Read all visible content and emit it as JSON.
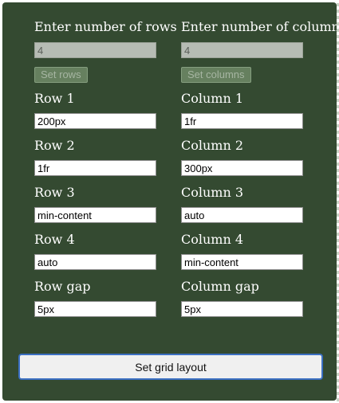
{
  "rows": {
    "count_label": "Enter number of rows",
    "count_value": "4",
    "set_button": "Set rows",
    "items": [
      {
        "label": "Row 1",
        "value": "200px"
      },
      {
        "label": "Row 2",
        "value": "1fr"
      },
      {
        "label": "Row 3",
        "value": "min-content"
      },
      {
        "label": "Row 4",
        "value": "auto"
      }
    ],
    "gap_label": "Row gap",
    "gap_value": "5px"
  },
  "columns": {
    "count_label": "Enter number of columns",
    "count_value": "4",
    "set_button": "Set columns",
    "items": [
      {
        "label": "Column 1",
        "value": "1fr"
      },
      {
        "label": "Column 2",
        "value": "300px"
      },
      {
        "label": "Column 3",
        "value": "auto"
      },
      {
        "label": "Column 4",
        "value": "min-content"
      }
    ],
    "gap_label": "Column gap",
    "gap_value": "5px"
  },
  "submit_button": "Set grid layout",
  "colors": {
    "panel_bg": "#344a31",
    "label_text": "#ffffff",
    "focus_border": "#3b6fc2"
  }
}
